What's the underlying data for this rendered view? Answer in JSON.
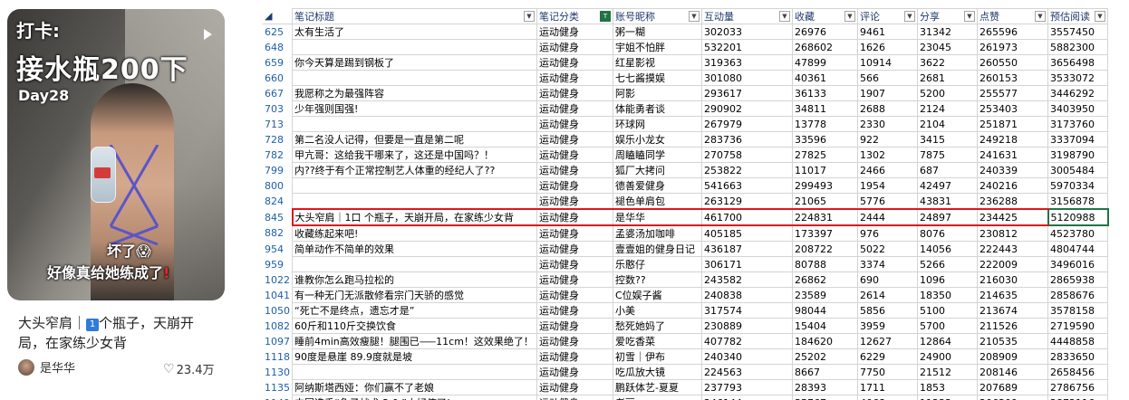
{
  "card": {
    "overlay": {
      "line1": "打卡:",
      "line2": "接水瓶200下",
      "line3": "Day28",
      "line4": "坏了😱",
      "line5": "好像真给她练成了",
      "line5_mark": "!"
    },
    "caption_pre": "大头窄肩｜",
    "caption_badge": "1",
    "caption_post": "个瓶子，天崩开局，在家练少女背",
    "author": "是华华",
    "likes": "23.4万"
  },
  "sheet": {
    "headers": [
      "笔记标题",
      "笔记分类",
      "账号昵称",
      "互动量",
      "收藏",
      "评论",
      "分享",
      "点赞",
      "预估阅读"
    ],
    "highlight_row": "845",
    "rows": [
      [
        "625",
        "太有生活了",
        "运动健身",
        "粥一糊",
        "302033",
        "26976",
        "9461",
        "31342",
        "265596",
        "3557450"
      ],
      [
        "648",
        "",
        "运动健身",
        "宇姐不怕胖",
        "532201",
        "268602",
        "1626",
        "23045",
        "261973",
        "5882300"
      ],
      [
        "659",
        "你今天算是踢到钢板了",
        "运动健身",
        "红星影视",
        "319363",
        "47899",
        "10914",
        "3622",
        "260550",
        "3656498"
      ],
      [
        "660",
        "",
        "运动健身",
        "七七酱摸娱",
        "301080",
        "40361",
        "566",
        "2681",
        "260153",
        "3533072"
      ],
      [
        "667",
        "我愿称之为最强阵容",
        "运动健身",
        "阿影",
        "293617",
        "36133",
        "1907",
        "5200",
        "255577",
        "3446292"
      ],
      [
        "703",
        "少年强则国强!",
        "运动健身",
        "体能勇者谈",
        "290902",
        "34811",
        "2688",
        "2124",
        "253403",
        "3403950"
      ],
      [
        "713",
        "",
        "运动健身",
        "环球网",
        "267979",
        "13778",
        "2330",
        "2104",
        "251871",
        "3173760"
      ],
      [
        "728",
        "第二名没人记得，但要是一直是第二呢",
        "运动健身",
        "娱乐小龙女",
        "283736",
        "33596",
        "922",
        "3415",
        "249218",
        "3337094"
      ],
      [
        "782",
        "甲亢哥：这给我干哪来了，这还是中国吗？！",
        "运动健身",
        "周瞌瞌同学",
        "270758",
        "27825",
        "1302",
        "7875",
        "241631",
        "3198790"
      ],
      [
        "799",
        "内??终于有个正常控制艺人体重的经纪人了??",
        "运动健身",
        "狐厂大拷问",
        "253822",
        "11017",
        "2466",
        "687",
        "240339",
        "3005484"
      ],
      [
        "800",
        "",
        "运动健身",
        "德善爱健身",
        "541663",
        "299493",
        "1954",
        "42497",
        "240216",
        "5970334"
      ],
      [
        "824",
        "",
        "运动健身",
        "褪色单肩包",
        "263129",
        "21065",
        "5776",
        "43831",
        "236288",
        "3156878"
      ],
      [
        "845",
        "大头窄肩｜1口 个瓶子，天崩开局，在家练少女背",
        "运动健身",
        "是华华",
        "461700",
        "224831",
        "2444",
        "24897",
        "234425",
        "5120988"
      ],
      [
        "882",
        "收藏练起来吧!",
        "运动健身",
        "孟婆汤加咖啡",
        "405185",
        "173397",
        "976",
        "8076",
        "230812",
        "4523780"
      ],
      [
        "954",
        "简单动作不简单的效果",
        "运动健身",
        "壹壹姐的健身日记",
        "436187",
        "208722",
        "5022",
        "14056",
        "222443",
        "4804744"
      ],
      [
        "959",
        "",
        "运动健身",
        "乐憨仔",
        "306171",
        "80788",
        "3374",
        "5266",
        "222009",
        "3496016"
      ],
      [
        "1022",
        "谁教你怎么跑马拉松的",
        "运动健身",
        "控数??",
        "243582",
        "26862",
        "690",
        "1096",
        "216030",
        "2865938"
      ],
      [
        "1041",
        "有一种无门无派散修看宗门天骄的感觉",
        "运动健身",
        "C位娱子酱",
        "240838",
        "23589",
        "2614",
        "18350",
        "214635",
        "2858676"
      ],
      [
        "1050",
        "“死亡不是终点，遗忘才是”",
        "运动健身",
        "小美",
        "317574",
        "98044",
        "5856",
        "5100",
        "213674",
        "3578158"
      ],
      [
        "1082",
        "60斤和110斤交换饮食",
        "运动健身",
        "愁死她妈了",
        "230889",
        "15404",
        "3959",
        "5700",
        "211526",
        "2719590"
      ],
      [
        "1097",
        "睡前4min高效瘦腿！腿围已⸺11cm！这效果绝了！",
        "运动健身",
        "爱吃香菜",
        "407782",
        "184620",
        "12627",
        "12864",
        "210535",
        "4448858"
      ],
      [
        "1118",
        "90度是悬崖 89.9度就是坡",
        "运动健身",
        "初雪｜伊布",
        "240340",
        "25202",
        "6229",
        "24900",
        "208909",
        "2833650"
      ],
      [
        "1130",
        "",
        "运动健身",
        "吃瓜放大镜",
        "224563",
        "8667",
        "7750",
        "21512",
        "208146",
        "2658456"
      ],
      [
        "1135",
        "阿纳斯塔西娅：你们赢不了老娘",
        "运动健身",
        "鹏跃体艺-夏夏",
        "237793",
        "28393",
        "1711",
        "1853",
        "207689",
        "2786756"
      ],
      [
        "1149",
        "中国选手“兔子战术 2.0 ”太好使了!",
        "运动健身",
        "老豆",
        "246144",
        "35767",
        "4068",
        "11233",
        "206309",
        "2872116"
      ]
    ]
  }
}
